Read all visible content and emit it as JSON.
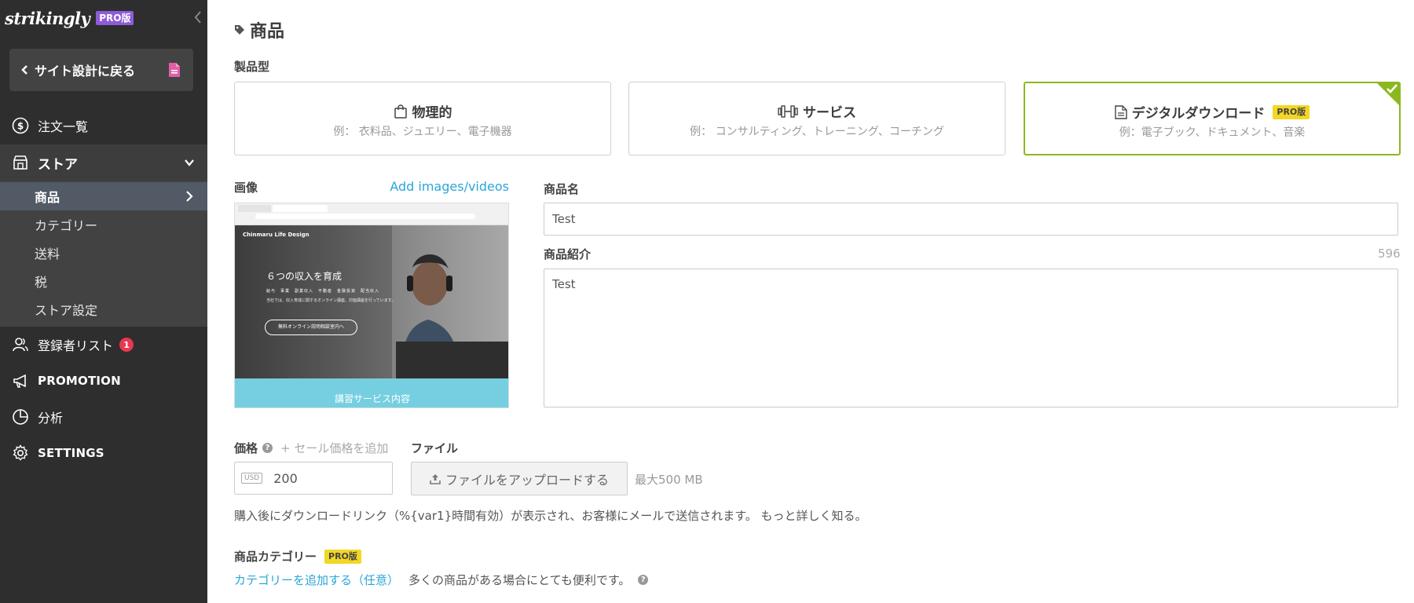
{
  "brand": {
    "name": "strikingly",
    "pro_badge": "PRO版"
  },
  "sidebar": {
    "back_label": "サイト設計に戻る",
    "orders_label": "注文一覧",
    "store_label": "ストア",
    "store_items": [
      {
        "label": "商品"
      },
      {
        "label": "カテゴリー"
      },
      {
        "label": "送料"
      },
      {
        "label": "税"
      },
      {
        "label": "ストア設定"
      }
    ],
    "subscribers_label": "登録者リスト",
    "subscribers_count": "1",
    "promotion_label": "PROMOTION",
    "analytics_label": "分析",
    "settings_label": "SETTINGS"
  },
  "main": {
    "title": "商品",
    "product_type_label": "製品型",
    "types": [
      {
        "title": "物理的",
        "desc": "例： 衣料品、ジュエリー、電子機器"
      },
      {
        "title": "サービス",
        "desc": "例： コンサルティング、トレーニング、コーチング"
      },
      {
        "title": "デジタルダウンロード",
        "desc": "例：電子ブック、ドキュメント、音楽",
        "badge": "PRO版"
      }
    ],
    "image_label": "画像",
    "add_images_link": "Add images/videos",
    "preview": {
      "site_name": "Chinmaru Life Design",
      "headline": "６つの収入を育成",
      "tags": "給与　事業　副業収入　不動産　金融投資　配当収入",
      "sub": "当社では、収入育成に関するオンライン講座、対面講座を行っています。",
      "cta": "無料オンライン説明相談室内へ",
      "footer": "講習サービス内容"
    },
    "name_label": "商品名",
    "name_value": "Test",
    "desc_label": "商品紹介",
    "desc_counter": "596",
    "desc_value": "Test",
    "price_label": "価格",
    "add_sale_price": "+ セール価格を追加",
    "currency": "USD",
    "price_value": "200",
    "file_label": "ファイル",
    "upload_label": "ファイルをアップロードする",
    "max_size": "最大500 MB",
    "download_note": "購入後にダウンロードリンク（%{var1}時間有効）が表示され、お客様にメールで送信されます。 もっと詳しく知る。",
    "category_label": "商品カテゴリー",
    "category_badge": "PRO版",
    "add_category_link": "カテゴリーを追加する（任意）",
    "category_hint": "多くの商品がある場合にとても便利です。"
  }
}
